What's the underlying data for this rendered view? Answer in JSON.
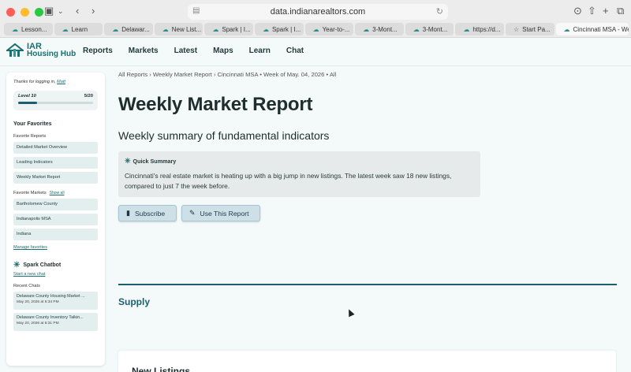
{
  "browser": {
    "url": "data.indianarealtors.com",
    "tabs": [
      {
        "label": "Lesson..."
      },
      {
        "label": "Learn"
      },
      {
        "label": "Delawar..."
      },
      {
        "label": "New List..."
      },
      {
        "label": "Spark | I..."
      },
      {
        "label": "Spark | I..."
      },
      {
        "label": "Year-to-..."
      },
      {
        "label": "3-Mont..."
      },
      {
        "label": "3-Mont..."
      },
      {
        "label": "https://d..."
      },
      {
        "label": "Start Pa..."
      },
      {
        "label": "Cincinnati MSA - We..."
      }
    ]
  },
  "app": {
    "logo_line1": "IAR",
    "logo_line2": "Housing Hub",
    "nav": [
      "Reports",
      "Markets",
      "Latest",
      "Maps",
      "Learn",
      "Chat"
    ]
  },
  "sidebar": {
    "login_prefix": "Thanks for logging in,",
    "login_name": "Matt",
    "level_label": "Level 10",
    "level_points": "5/20",
    "level_progress": 0.25,
    "favorites_title": "Your Favorites",
    "favorite_reports_title": "Favorite Reports",
    "favorite_reports": [
      "Detailed Market Overview",
      "Leading Indicators",
      "Weekly Market Report"
    ],
    "favorite_markets_title": "Favorite Markets",
    "show_all": "Show all",
    "favorite_markets": [
      "Bartholomew County",
      "Indianapolis MSA",
      "Indiana"
    ],
    "manage_favorites": "Manage favorites",
    "chatbot_title": "Spark Chatbot",
    "start_chat": "Start a new chat",
    "recent_chats_title": "Recent Chats",
    "recent_chats": [
      {
        "title": "Delaware County Housing Market ...",
        "date": "May 20, 2026 at 6:34 PM"
      },
      {
        "title": "Delaware County Inventory Talkin...",
        "date": "May 20, 2026 at 6:31 PM"
      }
    ]
  },
  "main": {
    "breadcrumb": "All Reports  ›  Weekly Market Report  ›  Cincinnati MSA • Week of May. 04, 2026 • All",
    "title": "Weekly Market Report",
    "subtitle": "Weekly summary of fundamental indicators",
    "quick_summary_title": "Quick Summary",
    "quick_summary_text": "Cincinnati's real estate market is heating up with a big jump in new listings. The latest week saw 18 new listings, compared to just 7 the week before.",
    "subscribe_label": "Subscribe",
    "use_report_label": "Use This Report",
    "section_title": "Supply",
    "card_title": "New Listings"
  },
  "colors": {
    "accent": "#1b5f6f",
    "brand_teal": "#1b6f6f",
    "background": "#f3faf9"
  }
}
